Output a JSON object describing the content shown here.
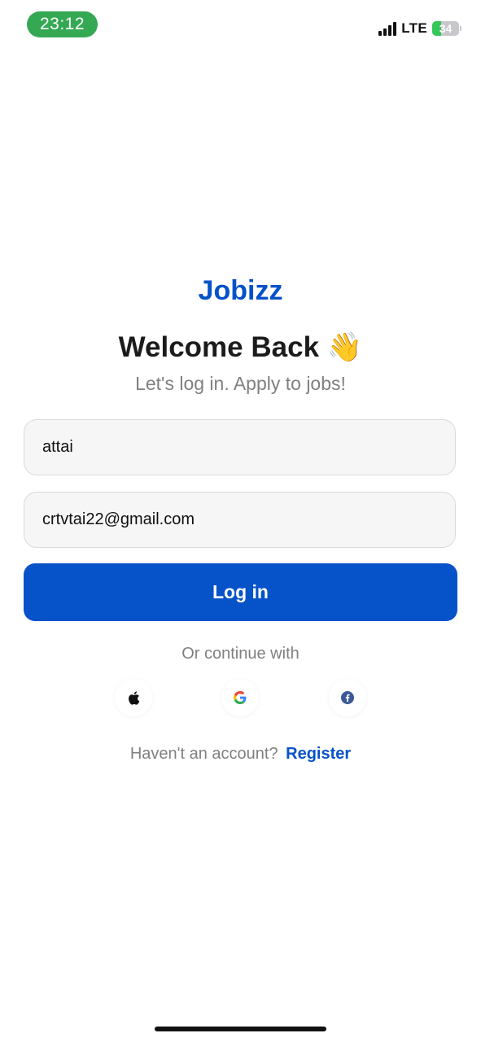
{
  "status_bar": {
    "time": "23:12",
    "network": "LTE",
    "battery_percent": "34",
    "battery_level": 0.34,
    "time_pill_color": "#34a853",
    "signal_bars": 4
  },
  "app": {
    "brand": "Jobizz",
    "brand_color": "#0652c9"
  },
  "header": {
    "title": "Welcome Back 👋",
    "subtitle": "Let's log in. Apply to jobs!"
  },
  "form": {
    "username_value": "attai",
    "email_value": "crtvtai22@gmail.com",
    "login_label": "Log in"
  },
  "social": {
    "divider_text": "Or continue with",
    "providers": [
      {
        "name": "apple-icon"
      },
      {
        "name": "google-icon"
      },
      {
        "name": "facebook-icon"
      }
    ]
  },
  "footer": {
    "prompt": "Haven't an account?",
    "register_label": "Register"
  }
}
